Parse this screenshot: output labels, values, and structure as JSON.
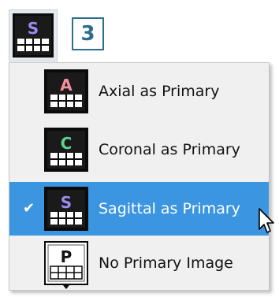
{
  "toolbar": {
    "active_icon": "sagittal-view-icon",
    "active_letter": "S",
    "step_number": "3"
  },
  "menu": {
    "items": [
      {
        "label": "Axial as Primary",
        "icon": "axial-view-icon",
        "letter": "A",
        "letter_color": "#f48f9d",
        "selected": false
      },
      {
        "label": "Coronal as Primary",
        "icon": "coronal-view-icon",
        "letter": "C",
        "letter_color": "#5fd18b",
        "selected": false
      },
      {
        "label": "Sagittal as Primary",
        "icon": "sagittal-view-icon",
        "letter": "S",
        "letter_color": "#9a8cf0",
        "selected": true,
        "check": "✔"
      },
      {
        "label": "No Primary Image",
        "icon": "no-primary-image-icon",
        "letter": "P",
        "letter_color": "#111111",
        "selected": false
      }
    ]
  },
  "colors": {
    "selection": "#3c95e0",
    "badge": "#2e6d8c"
  }
}
